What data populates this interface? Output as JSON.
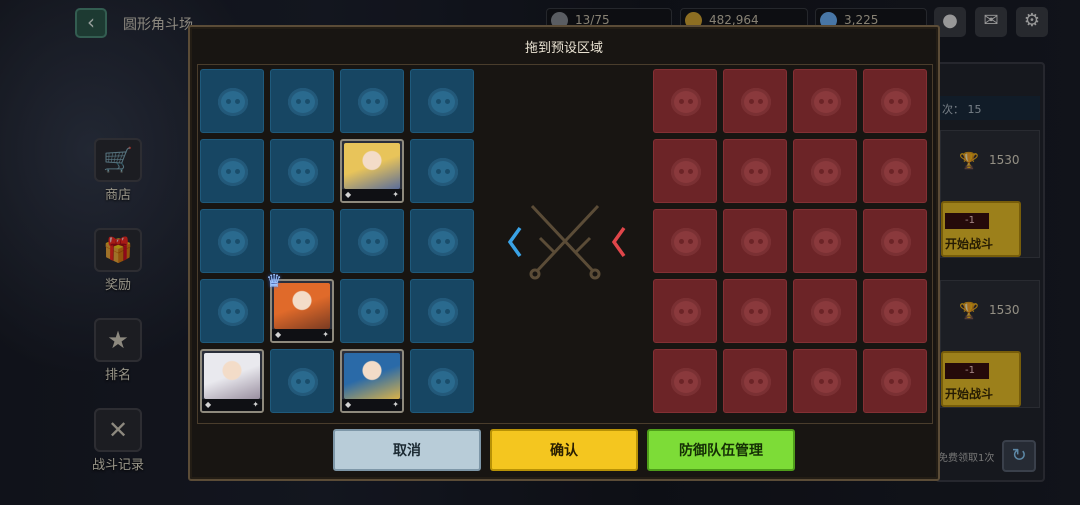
{
  "background": {
    "title": "圆形角斗场",
    "resources": [
      {
        "name": "stamina-icon",
        "value": "13/75",
        "color": "#9aa0a8"
      },
      {
        "name": "gold-coin-icon",
        "value": "482,964",
        "color": "#d9a935"
      },
      {
        "name": "gem-icon",
        "value": "3,225",
        "color": "#6fb6ff"
      }
    ],
    "side_menu": [
      {
        "label": "商店",
        "icon": "shopping-cart-icon"
      },
      {
        "label": "奖励",
        "icon": "gift-icon"
      },
      {
        "label": "排名",
        "icon": "podium-icon"
      },
      {
        "label": "战斗记录",
        "icon": "battle-record-icon"
      }
    ],
    "right_panel": {
      "count_text": "次：  15",
      "cards": [
        {
          "score": "1530",
          "cost": "-1",
          "button": "开始战斗"
        },
        {
          "score": "1530",
          "cost": "-1",
          "button": "开始战斗"
        }
      ],
      "free_text": "免费领取1次"
    }
  },
  "modal": {
    "title": "拖到预设区域",
    "ally_grid": [
      [
        "empty",
        "empty",
        "empty",
        "empty"
      ],
      [
        "empty",
        "empty",
        "hero",
        "empty"
      ],
      [
        "empty",
        "empty",
        "empty",
        "empty"
      ],
      [
        "empty",
        "hero",
        "empty",
        "empty"
      ],
      [
        "hero",
        "empty",
        "hero",
        "empty"
      ]
    ],
    "heroes": [
      {
        "name": "blonde-knight-hero",
        "colors": [
          "#e8c45a",
          "#5a6d9a"
        ]
      },
      {
        "name": "red-hair-leader-hero",
        "colors": [
          "#e06a2a",
          "#7a3b22"
        ],
        "leader": true
      },
      {
        "name": "white-hair-sage-hero",
        "colors": [
          "#e9e9ee",
          "#9a8fa0"
        ]
      },
      {
        "name": "blue-hair-priestess-hero",
        "colors": [
          "#2a6aa8",
          "#d9b24a"
        ]
      }
    ],
    "buttons": {
      "cancel": "取消",
      "confirm": "确认",
      "defense": "防御队伍管理"
    },
    "colors": {
      "ally": "#174663",
      "enemy": "#6c2427",
      "ally_arrow": "#3aa3e6",
      "enemy_arrow": "#e0464a"
    }
  }
}
